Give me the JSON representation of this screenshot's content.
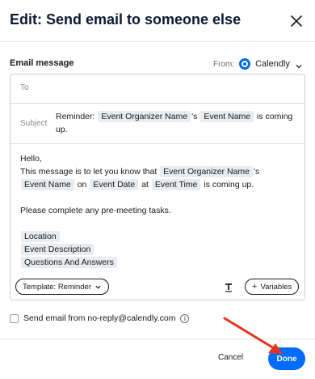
{
  "header": {
    "title": "Edit: Send email to someone else"
  },
  "email_message": {
    "section_label": "Email message",
    "from_label": "From:",
    "from_value": "Calendly",
    "to_label": "To",
    "subject_label": "Subject",
    "subject": {
      "prefix": "Reminder:",
      "chip1": "Event Organizer Name",
      "mid": "'s",
      "chip2": "Event Name",
      "suffix": "is coming up."
    },
    "body": {
      "greeting": "Hello,",
      "line1_prefix": "This message is to let you know that",
      "line1_chip": "Event Organizer Name",
      "line1_suffix": "'s",
      "line2_chip1": "Event Name",
      "line2_on": "on",
      "line2_chip2": "Event Date",
      "line2_at": "at",
      "line2_chip3": "Event Time",
      "line2_suffix": "is coming up.",
      "line3": "Please complete any pre-meeting tasks.",
      "chips": [
        "Location",
        "Event Description",
        "Questions And Answers"
      ]
    },
    "template_button": "Template: Reminder",
    "variables_button": "Variables"
  },
  "noreply_label": "Send email from no-reply@calendly.com",
  "footer": {
    "cancel": "Cancel",
    "done": "Done"
  },
  "colors": {
    "accent": "#006bff",
    "arrow": "#e8341c",
    "chip_bg": "#e8ecf1"
  },
  "icons": [
    "close-icon",
    "calendly-logo-icon",
    "chevron-down-icon",
    "text-format-icon",
    "plus-icon",
    "info-icon",
    "annotation-arrow"
  ]
}
